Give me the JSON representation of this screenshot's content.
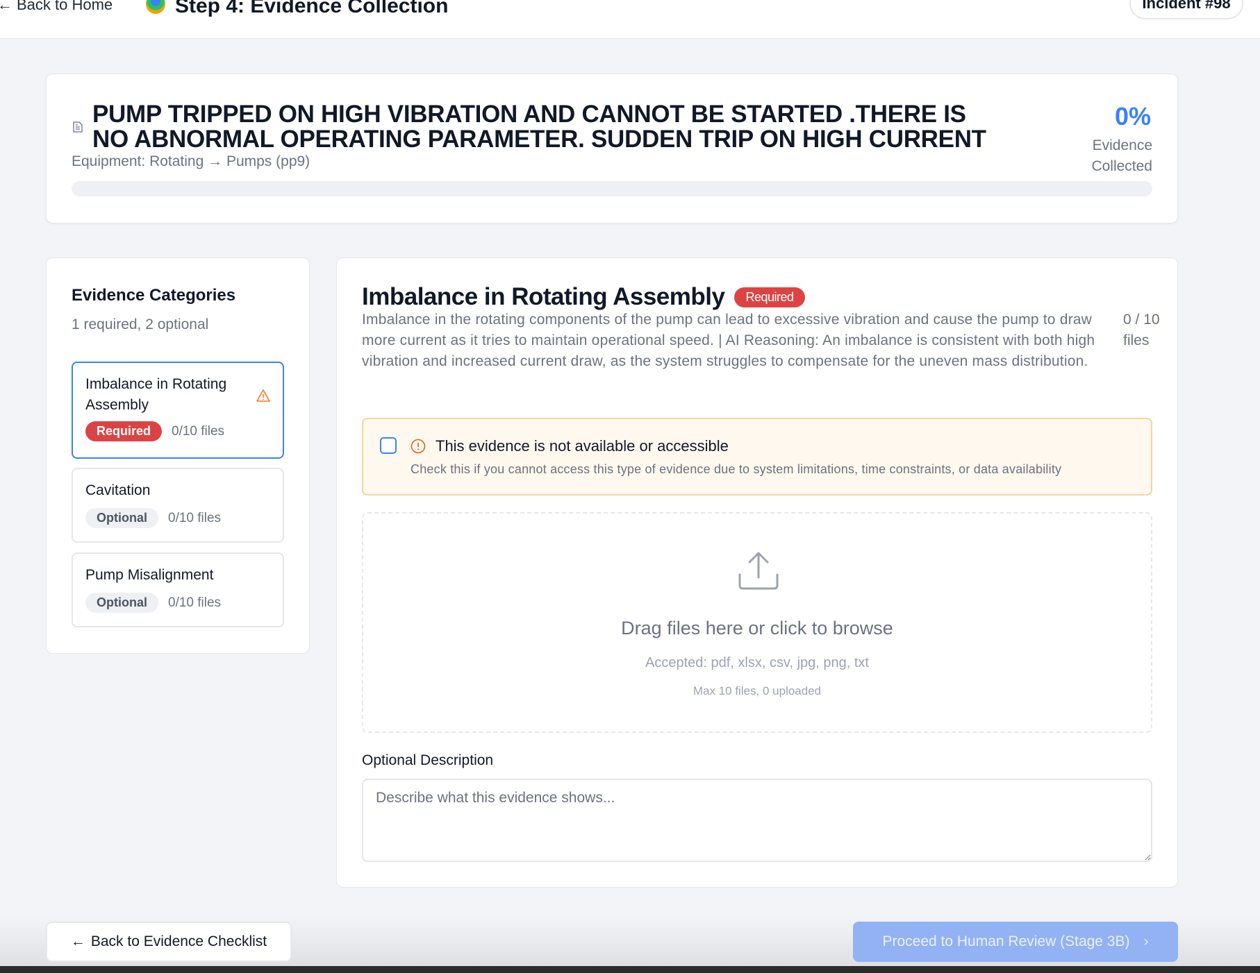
{
  "header": {
    "back_label": "Back to Home",
    "step_title": "Step 4: Evidence Collection",
    "incident": "Incident #98"
  },
  "summary": {
    "title": "PUMP TRIPPED ON HIGH VIBRATION AND CANNOT BE STARTED .THERE IS NO ABNORMAL OPERATING PARAMETER. SUDDEN TRIP ON HIGH CURRENT",
    "equipment": "Equipment: Rotating → Pumps (pp9)",
    "percent": "0%",
    "percent_label": "Evidence Collected",
    "progress_fraction": 0
  },
  "sidebar": {
    "title": "Evidence Categories",
    "subtitle": "1 required, 2 optional",
    "items": [
      {
        "name": "Imbalance in Rotating Assembly",
        "badge": "Required",
        "files": "0/10 files",
        "active": true,
        "icon": "warning-triangle-icon"
      },
      {
        "name": "Cavitation",
        "badge": "Optional",
        "files": "0/10 files",
        "active": false
      },
      {
        "name": "Pump Misalignment",
        "badge": "Optional",
        "files": "0/10 files",
        "active": false
      }
    ]
  },
  "main": {
    "title": "Imbalance in Rotating Assembly",
    "badge": "Required",
    "description": "Imbalance in the rotating components of the pump can lead to excessive vibration and cause the pump to draw more current as it tries to maintain operational speed. | AI Reasoning: An imbalance is consistent with both high vibration and increased current draw, as the system struggles to compensate for the uneven mass distribution.",
    "file_count": "0 / 10 files",
    "unavailable": {
      "title": "This evidence is not available or accessible",
      "subtitle": "Check this if you cannot access this type of evidence due to system limitations, time constraints, or data availability",
      "checked": false
    },
    "dropzone": {
      "text": "Drag files here or click to browse",
      "accepted": "Accepted: pdf, xlsx, csv, jpg, png, txt",
      "max": "Max 10 files, 0 uploaded"
    },
    "description_field": {
      "label": "Optional Description",
      "placeholder": "Describe what this evidence shows...",
      "value": ""
    }
  },
  "footer": {
    "back_label": "Back to Evidence Checklist",
    "proceed_label": "Proceed to Human Review (Stage 3B)"
  },
  "colors": {
    "accent": "#3b82f6",
    "required": "#dc4444",
    "warning_bg": "#fff8ef",
    "warning_border": "#f6d49b",
    "proceed_disabled": "#93b2f3"
  }
}
